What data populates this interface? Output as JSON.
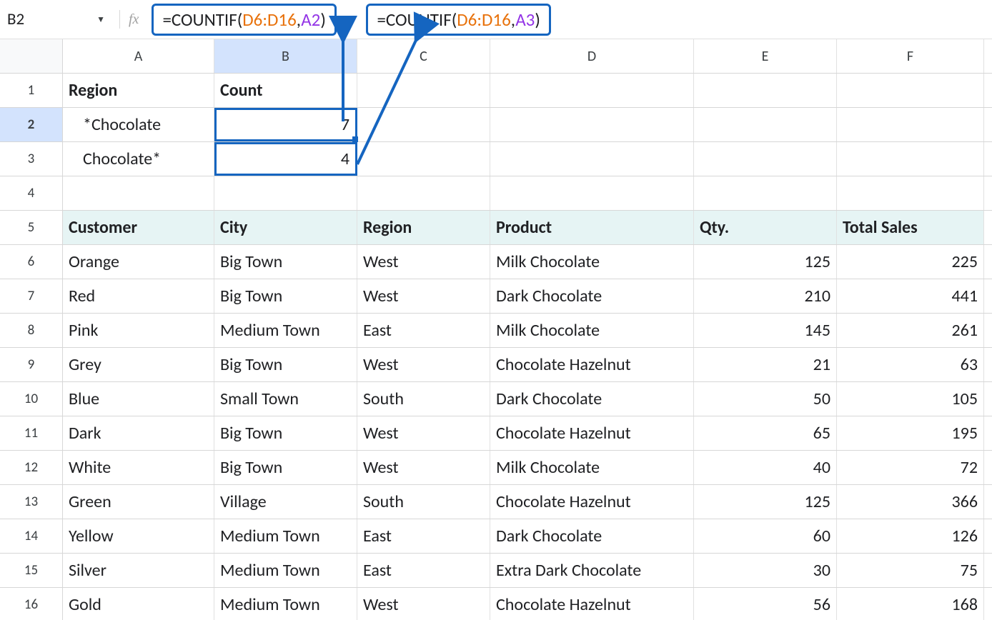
{
  "namebox": {
    "cell": "B2"
  },
  "formulas": {
    "b2": {
      "eq": "=",
      "fn": "COUNTIF",
      "open": "(",
      "range": "D6:D16",
      "comma": ",",
      "ref": "A2",
      "close": ")"
    },
    "b3": {
      "eq": "=",
      "fn": "COUNTIF",
      "open": "(",
      "range": "D6:D16",
      "comma": ",",
      "ref": "A3",
      "close": ")"
    }
  },
  "cols": [
    "A",
    "B",
    "C",
    "D",
    "E",
    "F"
  ],
  "section1": {
    "h_region": "Region",
    "h_count": "Count",
    "r2_label": "*Chocolate",
    "r2_val": "7",
    "r3_label": "Chocolate*",
    "r3_val": "4"
  },
  "headers": {
    "customer": "Customer",
    "city": "City",
    "region": "Region",
    "product": "Product",
    "qty": "Qty.",
    "total": "Total Sales"
  },
  "rows": {
    "6": {
      "customer": "Orange",
      "city": "Big Town",
      "region": "West",
      "product": "Milk Chocolate",
      "qty": "125",
      "total": "225"
    },
    "7": {
      "customer": "Red",
      "city": "Big Town",
      "region": "West",
      "product": "Dark Chocolate",
      "qty": "210",
      "total": "441"
    },
    "8": {
      "customer": "Pink",
      "city": "Medium Town",
      "region": "East",
      "product": "Milk Chocolate",
      "qty": "145",
      "total": "261"
    },
    "9": {
      "customer": "Grey",
      "city": "Big Town",
      "region": "West",
      "product": "Chocolate Hazelnut",
      "qty": "21",
      "total": "63"
    },
    "10": {
      "customer": "Blue",
      "city": "Small Town",
      "region": "South",
      "product": "Dark Chocolate",
      "qty": "50",
      "total": "105"
    },
    "11": {
      "customer": "Dark",
      "city": "Big Town",
      "region": "West",
      "product": "Chocolate Hazelnut",
      "qty": "65",
      "total": "195"
    },
    "12": {
      "customer": "White",
      "city": "Big Town",
      "region": "West",
      "product": "Milk Chocolate",
      "qty": "40",
      "total": "72"
    },
    "13": {
      "customer": "Green",
      "city": "Village",
      "region": "South",
      "product": "Chocolate Hazelnut",
      "qty": "125",
      "total": "366"
    },
    "14": {
      "customer": "Yellow",
      "city": "Medium Town",
      "region": "East",
      "product": "Dark Chocolate",
      "qty": "60",
      "total": "126"
    },
    "15": {
      "customer": "Silver",
      "city": "Medium Town",
      "region": "East",
      "product": "Extra Dark Chocolate",
      "qty": "30",
      "total": "75"
    },
    "16": {
      "customer": "Gold",
      "city": "Medium Town",
      "region": "West",
      "product": "Chocolate Hazelnut",
      "qty": "56",
      "total": "168"
    }
  }
}
